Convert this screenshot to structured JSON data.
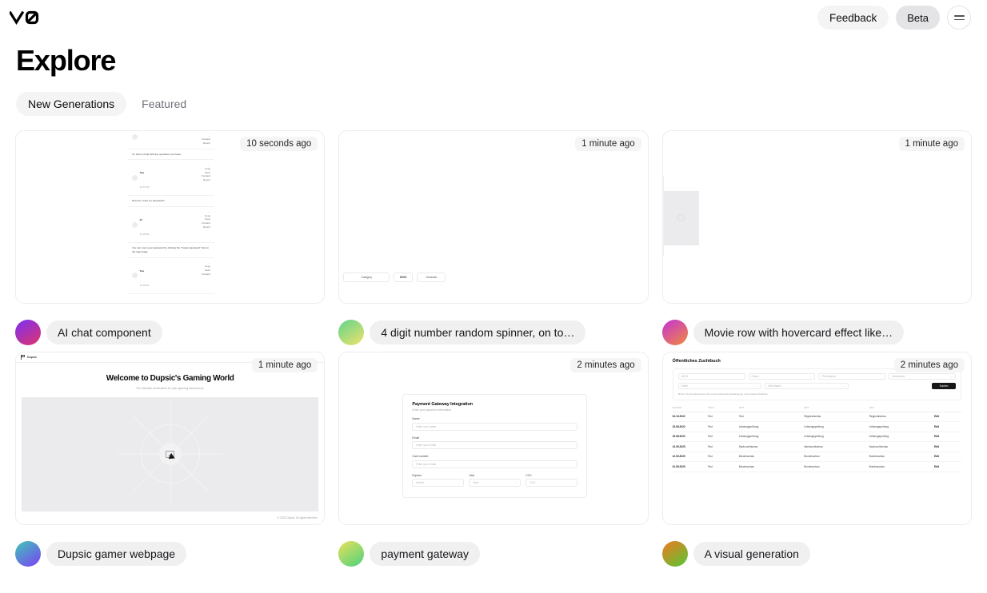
{
  "header": {
    "logo_icon": "v0-logo",
    "feedback_label": "Feedback",
    "beta_label": "Beta",
    "menu_icon": "hamburger-menu-icon"
  },
  "page": {
    "title": "Explore",
    "tabs": [
      {
        "label": "New Generations",
        "active": true
      },
      {
        "label": "Featured",
        "active": false
      }
    ]
  },
  "cards": [
    {
      "title": "AI chat component",
      "timestamp": "10 seconds ago",
      "avatar_from": "#7b2ff7",
      "avatar_to": "#e0356a",
      "preview": {
        "type": "ai-chat",
        "messages": [
          {
            "text": "I'm here to help with any questions you have."
          },
          {
            "who": "You",
            "time": "11:47 AM",
            "text": "How do I reset my password?"
          },
          {
            "who": "AI",
            "time": "11:48 AM",
            "text": "You can reset your password by clicking the \"Forgot password\" link on the login page."
          },
          {
            "who": "You",
            "time": "11:49 AM",
            "text": ""
          }
        ],
        "actions": [
          "Copy",
          "Save",
          "Forward",
          "Report"
        ]
      }
    },
    {
      "title": "4 digit number random spinner, on to…",
      "timestamp": "1 minute ago",
      "avatar_from": "#5fd38d",
      "avatar_to": "#f0e36a",
      "preview": {
        "type": "spinner",
        "category_label": "Category",
        "number_value": "0000",
        "generate_label": "Generate"
      }
    },
    {
      "title": "Movie row with hovercard effect like…",
      "timestamp": "1 minute ago",
      "avatar_from": "#c433d8",
      "avatar_to": "#f08a3c",
      "preview": {
        "type": "movie-row"
      }
    },
    {
      "title": "Dupsic gamer webpage",
      "timestamp": "1 minute ago",
      "avatar_from": "#3ec9b5",
      "avatar_to": "#7b3ff7",
      "preview": {
        "type": "dupsic",
        "brand": "Dupsic",
        "heading": "Welcome to Dupsic's Gaming World",
        "subheading": "The ultimate destination for epic gaming adventures.",
        "footer": "© 2023 Dupsic. All rights reserved."
      }
    },
    {
      "title": "payment gateway",
      "timestamp": "2 minutes ago",
      "avatar_from": "#e9e15a",
      "avatar_to": "#4cd17e",
      "preview": {
        "type": "payment",
        "heading": "Payment Gateway Integration",
        "subheading": "Enter your payment information.",
        "fields": [
          {
            "label": "Name",
            "placeholder": "Enter your name"
          },
          {
            "label": "Email",
            "placeholder": "Enter your email"
          },
          {
            "label": "Card number",
            "placeholder": "Enter your email"
          }
        ],
        "expiry": [
          {
            "label": "Expires",
            "placeholder": "Month"
          },
          {
            "label": "Year",
            "placeholder": "Year"
          },
          {
            "label": "CVC",
            "placeholder": "CVC"
          }
        ]
      }
    },
    {
      "title": "A visual generation",
      "timestamp": "2 minutes ago",
      "avatar_from": "#f07a1e",
      "avatar_to": "#56c736",
      "preview": {
        "type": "zuchtbuch",
        "heading": "Öffentliches Zuchtbuch",
        "search_row1": [
          "UELN",
          "Rasse",
          "Pferdename",
          "Geschlecht"
        ],
        "search_row2": [
          "Farbe",
          "Geburtsjahr"
        ],
        "search_button": "Suchen",
        "note": "Mit der Suche akzeptieren Sie unsere Datenschutzbedingung und Cookies Richtlinie.",
        "columns": [
          "DATUM",
          "TEXT",
          "ART",
          "ART",
          "ART",
          ""
        ],
        "rows": [
          [
            "04.10.2022",
            "Test",
            "Test",
            "Regionalschau",
            "Regionalschau",
            "Edit"
          ],
          [
            "15.08.2022",
            "Test",
            "Leistungsprüfung",
            "Leistungsprüfung",
            "Leistungsprüfung",
            "Edit"
          ],
          [
            "15.08.2022",
            "Test",
            "Leistungsprüfung",
            "Leistungsprüfung",
            "Leistungsprüfung",
            "Edit"
          ],
          [
            "13.09.2020",
            "Test",
            "Nachzuchtschau",
            "Nachzuchtschau",
            "Nachzuchtschau",
            "Edit"
          ],
          [
            "12.09.2020",
            "Test",
            "Bundesschau",
            "Bundesschau",
            "Bundesschau",
            "Edit"
          ],
          [
            "01.08.2020",
            "Test",
            "Bundesschau",
            "Bundesschau",
            "Bundesschau",
            "Edit"
          ]
        ]
      }
    }
  ]
}
